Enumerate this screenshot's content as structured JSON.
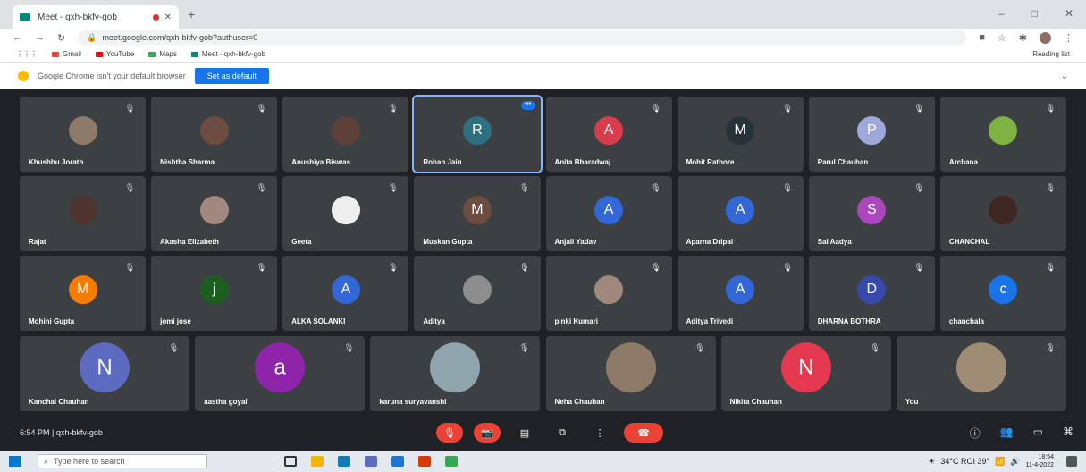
{
  "browser": {
    "tab_title": "Meet - qxh-bkfv-gob",
    "new_tab": "+",
    "window_controls": [
      "–",
      "□",
      "✕"
    ],
    "url": "meet.google.com/qxh-bkfv-gob?authuser=0",
    "bookmarks": [
      {
        "label": "Gmail",
        "color": "#ea4335"
      },
      {
        "label": "YouTube",
        "color": "#ff0000"
      },
      {
        "label": "Maps",
        "color": "#34a853"
      },
      {
        "label": "Meet - qxh-bkfv-gob",
        "color": "#00897b"
      }
    ],
    "reading_list": "Reading list",
    "infobar_text": "Google Chrome isn't your default browser",
    "infobar_button": "Set as default"
  },
  "participants": [
    {
      "name": "Khushbu Jorath",
      "initial": "",
      "color": "#8d7b68"
    },
    {
      "name": "Nishtha Sharma",
      "initial": "",
      "color": "#6d4c41"
    },
    {
      "name": "Anushiya Biswas",
      "initial": "",
      "color": "#5d4037"
    },
    {
      "name": "Rohan Jain",
      "initial": "R",
      "color": "#2e6f80",
      "active": true
    },
    {
      "name": "Anita Bharadwaj",
      "initial": "A",
      "color": "#d93c4a"
    },
    {
      "name": "Mohit Rathore",
      "initial": "M",
      "color": "#263238"
    },
    {
      "name": "Parul Chauhan",
      "initial": "P",
      "color": "#9fa8da"
    },
    {
      "name": "Archana",
      "initial": "",
      "color": "#7cb342"
    },
    {
      "name": "Rajat",
      "initial": "",
      "color": "#4e342e"
    },
    {
      "name": "Akasha Elizabeth",
      "initial": "",
      "color": "#a1887f"
    },
    {
      "name": "Geeta",
      "initial": "",
      "color": "#eeeeee"
    },
    {
      "name": "Muskan Gupta",
      "initial": "M",
      "color": "#6d4c41"
    },
    {
      "name": "Anjali Yadav",
      "initial": "A",
      "color": "#3367d6"
    },
    {
      "name": "Aparna Dripal",
      "initial": "A",
      "color": "#3367d6"
    },
    {
      "name": "Sai Aadya",
      "initial": "S",
      "color": "#ab47bc"
    },
    {
      "name": "CHANCHAL",
      "initial": "",
      "color": "#3e2723"
    },
    {
      "name": "Mohini Gupta",
      "initial": "M",
      "color": "#f57c00"
    },
    {
      "name": "jomi jose",
      "initial": "j",
      "color": "#1b5e20"
    },
    {
      "name": "ALKA SOLANKI",
      "initial": "A",
      "color": "#3367d6"
    },
    {
      "name": "Aditya",
      "initial": "",
      "color": "#8d8d8d"
    },
    {
      "name": "pinki Kumari",
      "initial": "",
      "color": "#a1887f"
    },
    {
      "name": "Aditya Trivedi",
      "initial": "A",
      "color": "#3367d6"
    },
    {
      "name": "DHARNA BOTHRA",
      "initial": "D",
      "color": "#3949ab"
    },
    {
      "name": "chanchala",
      "initial": "c",
      "color": "#1a73e8"
    },
    {
      "name": "Kanchal Chauhan",
      "initial": "N",
      "color": "#5c6bc0"
    },
    {
      "name": "aastha goyal",
      "initial": "a",
      "color": "#8e24aa"
    },
    {
      "name": "karuna suryavanshi",
      "initial": "",
      "color": "#90a4ae"
    },
    {
      "name": "Neha Chauhan",
      "initial": "",
      "color": "#8d7b68"
    },
    {
      "name": "Nikita Chauhan",
      "initial": "N",
      "color": "#e53950"
    },
    {
      "name": "You",
      "initial": "",
      "color": "#9e8c74"
    }
  ],
  "meeting": {
    "time_code": "6:54 PM  |  qxh-bkfv-gob"
  },
  "controls": {
    "mic": "🎙",
    "camera": "📷",
    "captions": "▤",
    "present": "⧉",
    "more": "⋮",
    "end": "☎"
  },
  "taskbar": {
    "search_placeholder": "Type here to search",
    "weather": "34°C ROI 39°",
    "time": "18:54",
    "date": "11-4-2022"
  }
}
